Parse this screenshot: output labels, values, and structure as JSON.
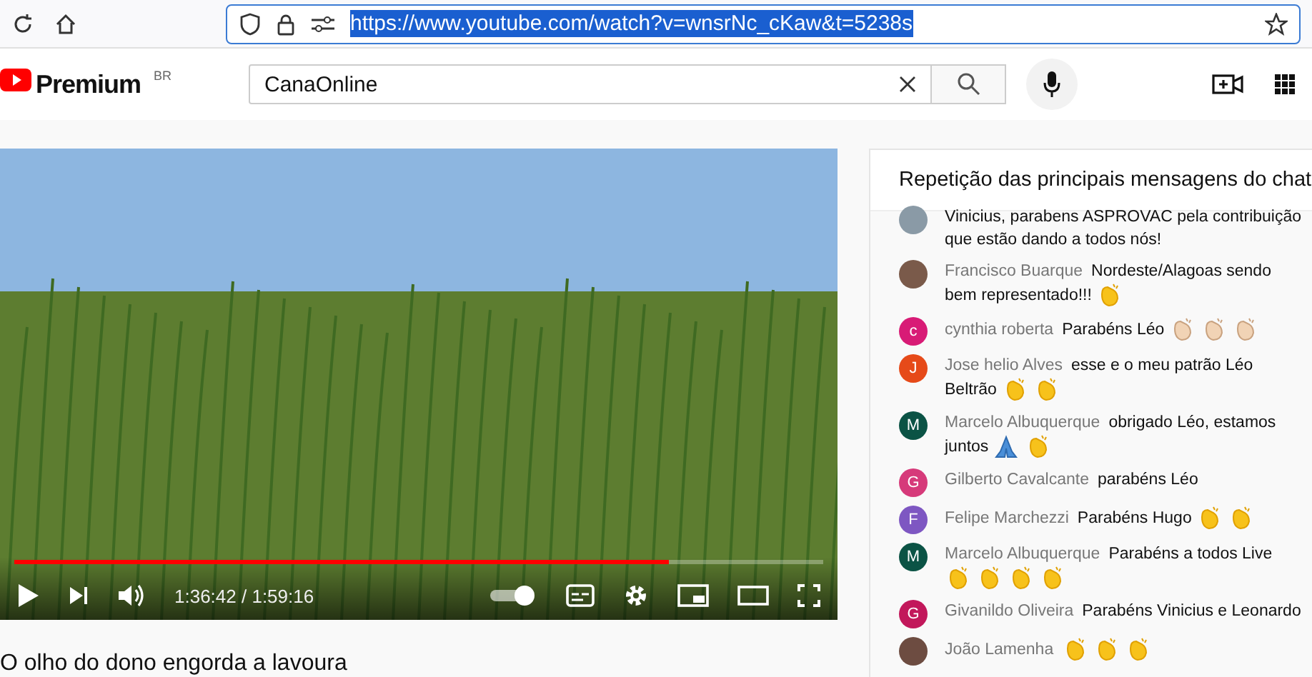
{
  "browser": {
    "url": "https://www.youtube.com/watch?v=wnsrNc_cKaw&t=5238s",
    "url_selected": true
  },
  "header": {
    "logo_text": "Premium",
    "region": "BR",
    "search_value": "CanaOnline"
  },
  "player": {
    "level": 0.81,
    "time": "1:36:42 / 1:59:16"
  },
  "video_title": "O olho do dono engorda a lavoura",
  "chat": {
    "title": "Repetição das principais mensagens do chat",
    "messages": [
      {
        "avatar": {
          "kind": "photo",
          "color": "#8a9aa6"
        },
        "text": "Vinicius, parabens ASPROVAC pela contribuição que estão dando a todos nós!"
      },
      {
        "avatar": {
          "kind": "photo",
          "color": "#7a5a4a"
        },
        "author": "Francisco Buarque",
        "text": "Nordeste/Alagoas sendo bem representado!!!",
        "emojis": [
          {
            "kind": "clap"
          }
        ]
      },
      {
        "avatar": {
          "kind": "letter",
          "letter": "c",
          "color": "#d81b76"
        },
        "author": "cynthia roberta",
        "text": "Parabéns Léo",
        "emojis": [
          {
            "kind": "clap-light"
          },
          {
            "kind": "clap-light"
          },
          {
            "kind": "clap-light"
          }
        ]
      },
      {
        "avatar": {
          "kind": "letter",
          "letter": "J",
          "color": "#e64a19"
        },
        "author": "Jose helio Alves",
        "text": "esse e o meu patrão Léo Beltrão",
        "emojis": [
          {
            "kind": "clap"
          },
          {
            "kind": "clap"
          }
        ]
      },
      {
        "avatar": {
          "kind": "letter",
          "letter": "M",
          "color": "#0b5345"
        },
        "author": "Marcelo Albuquerque",
        "text": "obrigado Léo, estamos juntos",
        "emojis": [
          {
            "kind": "pray"
          },
          {
            "kind": "clap"
          }
        ]
      },
      {
        "avatar": {
          "kind": "letter",
          "letter": "G",
          "color": "#d63a7a"
        },
        "author": "Gilberto Cavalcante",
        "text": "parabéns Léo"
      },
      {
        "avatar": {
          "kind": "letter",
          "letter": "F",
          "color": "#7e57c2"
        },
        "author": "Felipe Marchezzi",
        "text": "Parabéns Hugo",
        "emojis": [
          {
            "kind": "clap"
          },
          {
            "kind": "clap"
          }
        ]
      },
      {
        "avatar": {
          "kind": "letter",
          "letter": "M",
          "color": "#0b5345"
        },
        "author": "Marcelo Albuquerque",
        "text": "Parabéns a todos Live",
        "emojis": [
          {
            "kind": "clap"
          },
          {
            "kind": "clap"
          },
          {
            "kind": "clap"
          },
          {
            "kind": "clap"
          }
        ]
      },
      {
        "avatar": {
          "kind": "letter",
          "letter": "G",
          "color": "#c2185b"
        },
        "author": "Givanildo Oliveira",
        "text": "Parabéns Vinicius e Leonardo"
      },
      {
        "avatar": {
          "kind": "photo",
          "color": "#6d4c41"
        },
        "author": "João Lamenha",
        "emojis": [
          {
            "kind": "clap"
          },
          {
            "kind": "clap"
          },
          {
            "kind": "clap"
          }
        ]
      }
    ]
  }
}
